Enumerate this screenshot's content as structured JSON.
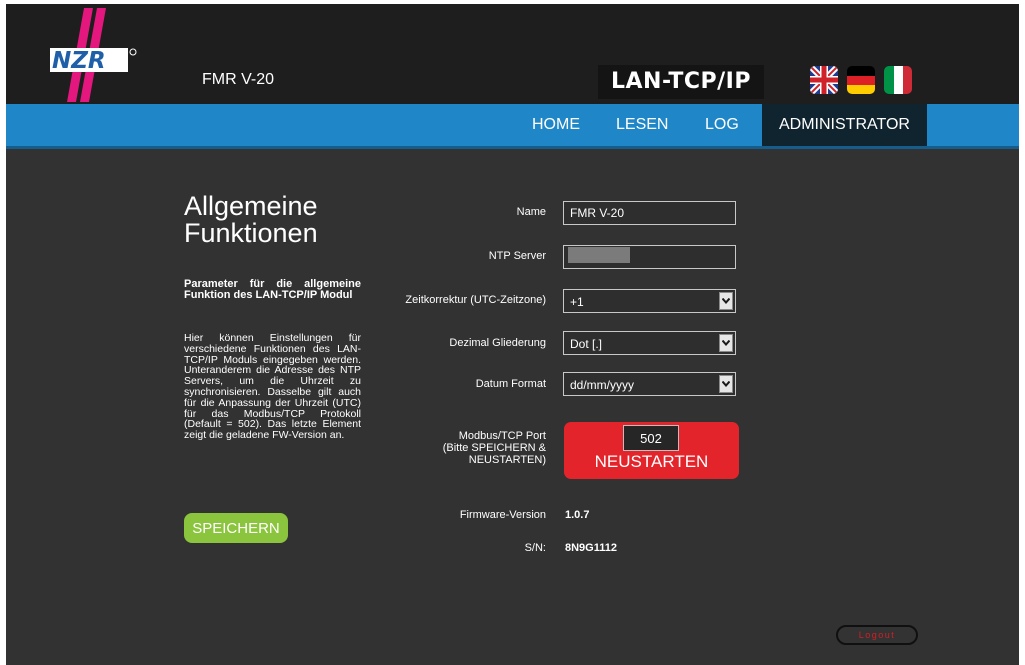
{
  "header": {
    "device_name": "FMR V-20",
    "module_title": "LAN-TCP/IP",
    "logo_text": "NZR",
    "languages": [
      "english-flag-icon",
      "german-flag-icon",
      "italian-flag-icon"
    ]
  },
  "nav": {
    "items": [
      "HOME",
      "LESEN",
      "LOG",
      "ADMINISTRATOR"
    ],
    "active": "ADMINISTRATOR"
  },
  "sidebar": {
    "title_line1": "Allgemeine",
    "title_line2": "Funktionen",
    "description_heading": "Parameter für die allgemeine Funktion des LAN-TCP/IP Modul",
    "description_body": "Hier können Einstellungen für verschiedene Funktionen des LAN-TCP/IP Moduls eingegeben werden. Unteranderem die Adresse des NTP Servers, um die Uhrzeit zu synchronisieren. Dasselbe gilt auch für die Anpassung der Uhrzeit (UTC) für das Modbus/TCP Protokoll (Default = 502). Das letzte Element zeigt die geladene FW-Version an.",
    "save_label": "SPEICHERN"
  },
  "form": {
    "name_label": "Name",
    "name_value": "FMR V-20",
    "ntp_label": "NTP Server",
    "ntp_value": "",
    "timezone_label": "Zeitkorrektur (UTC-Zeitzone)",
    "timezone_value": "+1",
    "decimal_label": "Dezimal Gliederung",
    "decimal_value": "Dot [.]",
    "date_label": "Datum Format",
    "date_value": "dd/mm/yyyy",
    "modbus_label_line1": "Modbus/TCP Port",
    "modbus_label_line2": "(Bitte SPEICHERN &",
    "modbus_label_line3": "NEUSTARTEN)",
    "modbus_port": "502",
    "restart_label": "NEUSTARTEN",
    "firmware_label": "Firmware-Version",
    "firmware_value": "1.0.7",
    "serial_label": "S/N:",
    "serial_value": "8N9G1112"
  },
  "footer": {
    "logout_label": "Logout"
  },
  "colors": {
    "nav_bar": "#1f87c7",
    "nav_active": "#10242f",
    "save_button": "#8bc43d",
    "restart_button": "#e3242b",
    "logo_pink": "#e3177e"
  }
}
